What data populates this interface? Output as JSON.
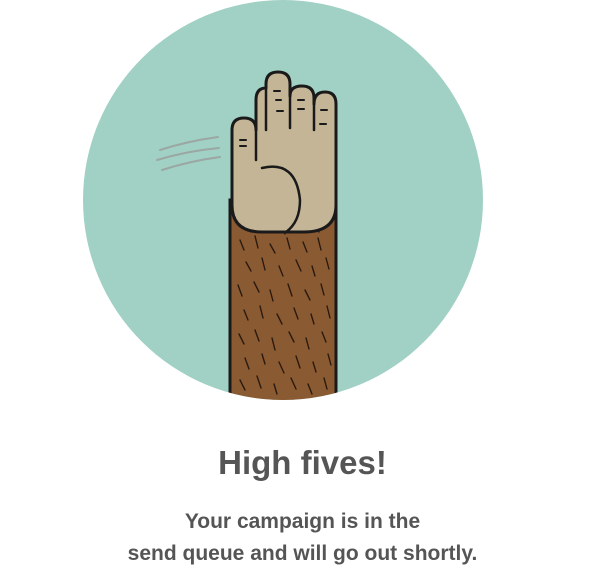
{
  "success": {
    "headline": "High fives!",
    "message_line1": "Your campaign is in the",
    "message_line2": "send queue and will go out shortly."
  },
  "illustration": {
    "icon": "high-five-hand-icon",
    "circle_color": "#a1d1c4",
    "palm_color": "#c4b597",
    "fur_color": "#8a5a33",
    "outline_color": "#1a1a1a",
    "motion_line_color": "#9aa7a3"
  },
  "colors": {
    "text": "#555555",
    "background": "#ffffff"
  }
}
